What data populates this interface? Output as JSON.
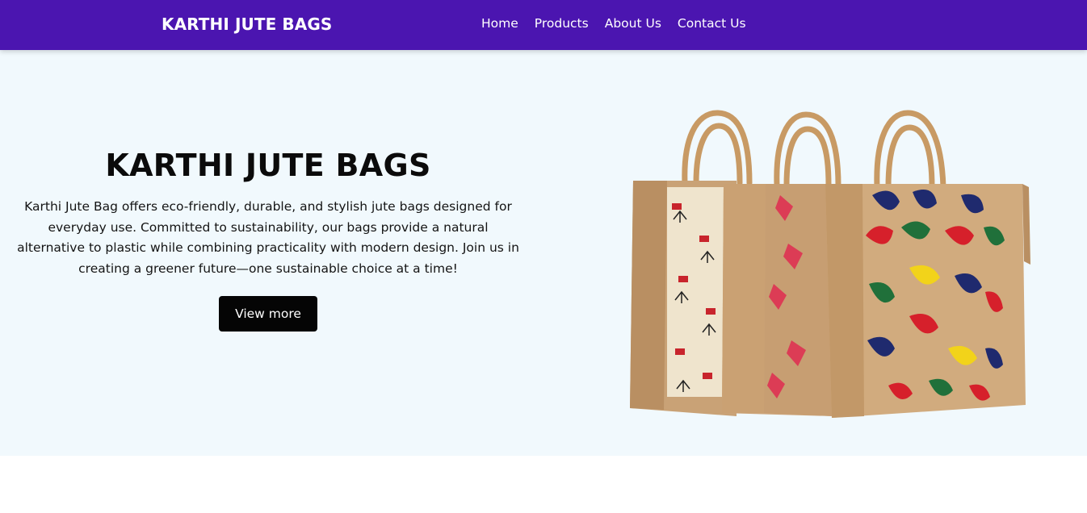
{
  "navbar": {
    "brand": "KARTHI JUTE BAGS",
    "links": [
      "Home",
      "Products",
      "About Us",
      "Contact Us"
    ],
    "background": "#4b15b0"
  },
  "hero": {
    "title": "KARTHI JUTE BAGS",
    "description": "Karthi Jute Bag offers eco-friendly, durable, and stylish jute bags designed for everyday use. Committed to sustainability, our bags provide a natural alternative to plastic while combining practicality with modern design. Join us in creating a greener future—one sustainable choice at a time!",
    "button_label": "View more",
    "background": "#f1f9fd"
  }
}
